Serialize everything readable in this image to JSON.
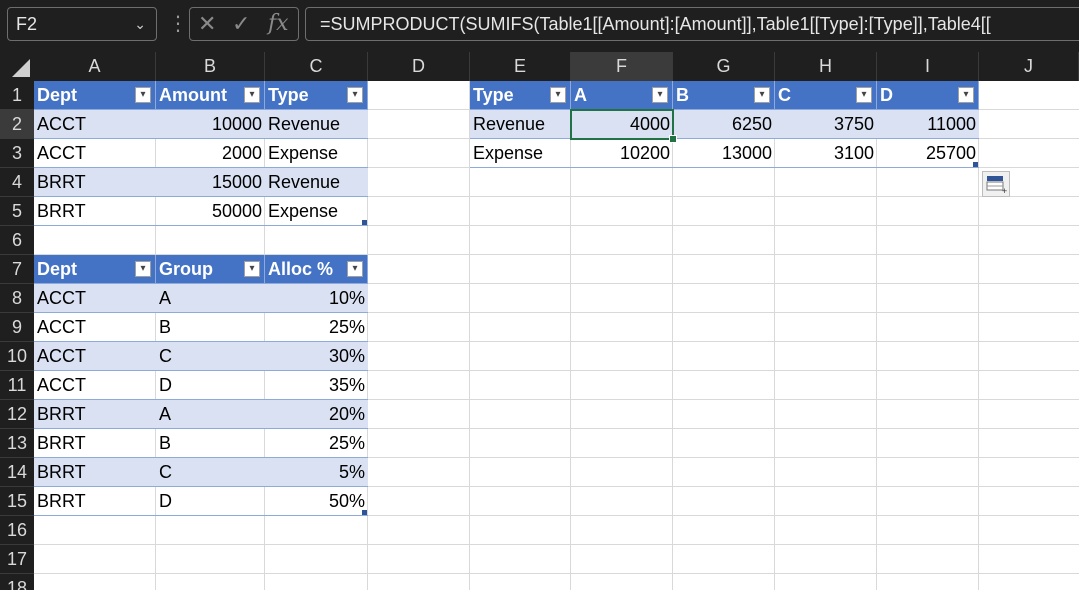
{
  "formula_bar": {
    "name_box": "F2",
    "formula": "=SUMPRODUCT(SUMIFS(Table1[[Amount]:[Amount]],Table1[[Type]:[Type]],Table4[["
  },
  "columns": [
    "A",
    "B",
    "C",
    "D",
    "E",
    "F",
    "G",
    "H",
    "I",
    "J"
  ],
  "rows": [
    "1",
    "2",
    "3",
    "4",
    "5",
    "6",
    "7",
    "8",
    "9",
    "10",
    "11",
    "12",
    "13",
    "14",
    "15",
    "16",
    "17",
    "18"
  ],
  "table1": {
    "headers": [
      "Dept",
      "Amount",
      "Type"
    ],
    "rows": [
      [
        "ACCT",
        "10000",
        "Revenue"
      ],
      [
        "ACCT",
        "2000",
        "Expense"
      ],
      [
        "BRRT",
        "15000",
        "Revenue"
      ],
      [
        "BRRT",
        "50000",
        "Expense"
      ]
    ]
  },
  "table2": {
    "headers": [
      "Dept",
      "Group",
      "Alloc %"
    ],
    "rows": [
      [
        "ACCT",
        "A",
        "10%"
      ],
      [
        "ACCT",
        "B",
        "25%"
      ],
      [
        "ACCT",
        "C",
        "30%"
      ],
      [
        "ACCT",
        "D",
        "35%"
      ],
      [
        "BRRT",
        "A",
        "20%"
      ],
      [
        "BRRT",
        "B",
        "25%"
      ],
      [
        "BRRT",
        "C",
        "5%"
      ],
      [
        "BRRT",
        "D",
        "50%"
      ]
    ]
  },
  "table4": {
    "headers": [
      "Type",
      "A",
      "B",
      "C",
      "D"
    ],
    "rows": [
      [
        "Revenue",
        "4000",
        "6250",
        "3750",
        "11000"
      ],
      [
        "Expense",
        "10200",
        "13000",
        "3100",
        "25700"
      ]
    ]
  },
  "icons": {
    "name_box_dropdown": "chevron-down-icon",
    "cancel": "x-icon",
    "enter": "check-icon",
    "insert_function": "fx-icon",
    "quick_analysis": "quick-analysis-icon"
  }
}
